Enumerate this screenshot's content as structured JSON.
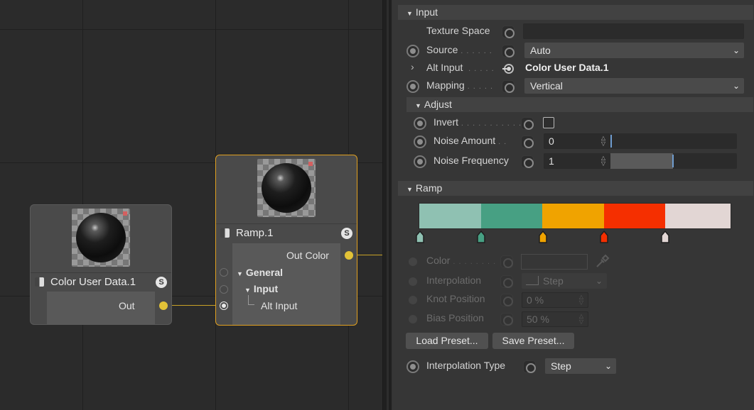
{
  "editor": {
    "node_color_user_data": {
      "title": "Color User Data.1",
      "badge": "S",
      "out_port": "Out"
    },
    "node_ramp": {
      "title": "Ramp.1",
      "badge": "S",
      "out_port": "Out Color",
      "inputs": [
        "General",
        "Input",
        "Alt Input"
      ]
    }
  },
  "panel": {
    "input_group": {
      "header": "Input",
      "texture_space_label": "Texture Space",
      "texture_space_value": "",
      "source_label": "Source",
      "source_dots": ". . . . . .",
      "source_value": "Auto",
      "alt_input_label": "Alt Input",
      "alt_input_dots": ". . . . .",
      "alt_input_value": "Color User Data.1",
      "mapping_label": "Mapping",
      "mapping_dots": ". . . . .",
      "mapping_value": "Vertical"
    },
    "adjust_group": {
      "header": "Adjust",
      "invert_label": "Invert",
      "invert_dots": ". . . . . . . . . . .",
      "invert_checked": false,
      "noise_amount_label": "Noise Amount",
      "noise_amount_dots": ". .",
      "noise_amount_value": "0",
      "noise_amount_fraction": 0.0,
      "noise_frequency_label": "Noise Frequency",
      "noise_frequency_value": "1",
      "noise_frequency_fraction": 0.5
    },
    "ramp_group": {
      "header": "Ramp",
      "segments": [
        "#8fc1b2",
        "#47a083",
        "#f0a300",
        "#f52f00",
        "#e2d6d4"
      ],
      "knots": [
        "#8fc1b2",
        "#47a083",
        "#f0a300",
        "#f52f00",
        "#e2d6d4"
      ],
      "color_label": "Color",
      "color_dots": ". . . . . . . .",
      "interpolation_label": "Interpolation",
      "interpolation_value": "Step",
      "knot_position_label": "Knot Position",
      "knot_position_value": "0 %",
      "bias_position_label": "Bias Position",
      "bias_position_value": "50 %",
      "load_preset": "Load Preset...",
      "save_preset": "Save Preset...",
      "interpolation_type_label": "Interpolation Type",
      "interpolation_type_value": "Step"
    },
    "colors": {
      "accent_selected": "#e0a020",
      "port_output": "#e2c237",
      "wire": "#c9a227"
    }
  }
}
